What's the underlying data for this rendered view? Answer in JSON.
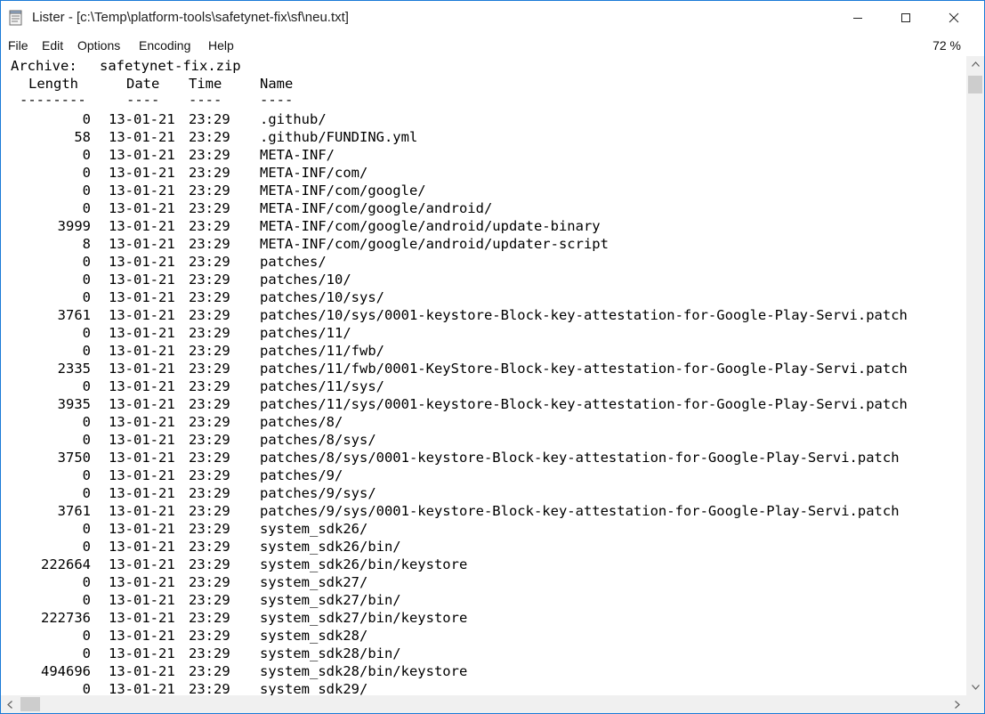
{
  "window": {
    "title": "Lister - [c:\\Temp\\platform-tools\\safetynet-fix\\sf\\neu.txt]"
  },
  "menu": {
    "items": [
      "File",
      "Edit",
      "Options",
      "Encoding",
      "Help"
    ],
    "zoom": "72 %"
  },
  "listing": {
    "archive_label": "Archive:",
    "archive_name": "safetynet-fix.zip",
    "headers": {
      "length": "Length",
      "date": "Date",
      "time": "Time",
      "name": "Name"
    },
    "separators": {
      "length": "--------",
      "date": "----",
      "time": "----",
      "name": "----"
    },
    "rows": [
      {
        "length": "0",
        "date": "13-01-21",
        "time": "23:29",
        "name": ".github/"
      },
      {
        "length": "58",
        "date": "13-01-21",
        "time": "23:29",
        "name": ".github/FUNDING.yml"
      },
      {
        "length": "0",
        "date": "13-01-21",
        "time": "23:29",
        "name": "META-INF/"
      },
      {
        "length": "0",
        "date": "13-01-21",
        "time": "23:29",
        "name": "META-INF/com/"
      },
      {
        "length": "0",
        "date": "13-01-21",
        "time": "23:29",
        "name": "META-INF/com/google/"
      },
      {
        "length": "0",
        "date": "13-01-21",
        "time": "23:29",
        "name": "META-INF/com/google/android/"
      },
      {
        "length": "3999",
        "date": "13-01-21",
        "time": "23:29",
        "name": "META-INF/com/google/android/update-binary"
      },
      {
        "length": "8",
        "date": "13-01-21",
        "time": "23:29",
        "name": "META-INF/com/google/android/updater-script"
      },
      {
        "length": "0",
        "date": "13-01-21",
        "time": "23:29",
        "name": "patches/"
      },
      {
        "length": "0",
        "date": "13-01-21",
        "time": "23:29",
        "name": "patches/10/"
      },
      {
        "length": "0",
        "date": "13-01-21",
        "time": "23:29",
        "name": "patches/10/sys/"
      },
      {
        "length": "3761",
        "date": "13-01-21",
        "time": "23:29",
        "name": "patches/10/sys/0001-keystore-Block-key-attestation-for-Google-Play-Servi.patch"
      },
      {
        "length": "0",
        "date": "13-01-21",
        "time": "23:29",
        "name": "patches/11/"
      },
      {
        "length": "0",
        "date": "13-01-21",
        "time": "23:29",
        "name": "patches/11/fwb/"
      },
      {
        "length": "2335",
        "date": "13-01-21",
        "time": "23:29",
        "name": "patches/11/fwb/0001-KeyStore-Block-key-attestation-for-Google-Play-Servi.patch"
      },
      {
        "length": "0",
        "date": "13-01-21",
        "time": "23:29",
        "name": "patches/11/sys/"
      },
      {
        "length": "3935",
        "date": "13-01-21",
        "time": "23:29",
        "name": "patches/11/sys/0001-keystore-Block-key-attestation-for-Google-Play-Servi.patch"
      },
      {
        "length": "0",
        "date": "13-01-21",
        "time": "23:29",
        "name": "patches/8/"
      },
      {
        "length": "0",
        "date": "13-01-21",
        "time": "23:29",
        "name": "patches/8/sys/"
      },
      {
        "length": "3750",
        "date": "13-01-21",
        "time": "23:29",
        "name": "patches/8/sys/0001-keystore-Block-key-attestation-for-Google-Play-Servi.patch"
      },
      {
        "length": "0",
        "date": "13-01-21",
        "time": "23:29",
        "name": "patches/9/"
      },
      {
        "length": "0",
        "date": "13-01-21",
        "time": "23:29",
        "name": "patches/9/sys/"
      },
      {
        "length": "3761",
        "date": "13-01-21",
        "time": "23:29",
        "name": "patches/9/sys/0001-keystore-Block-key-attestation-for-Google-Play-Servi.patch"
      },
      {
        "length": "0",
        "date": "13-01-21",
        "time": "23:29",
        "name": "system_sdk26/"
      },
      {
        "length": "0",
        "date": "13-01-21",
        "time": "23:29",
        "name": "system_sdk26/bin/"
      },
      {
        "length": "222664",
        "date": "13-01-21",
        "time": "23:29",
        "name": "system_sdk26/bin/keystore"
      },
      {
        "length": "0",
        "date": "13-01-21",
        "time": "23:29",
        "name": "system_sdk27/"
      },
      {
        "length": "0",
        "date": "13-01-21",
        "time": "23:29",
        "name": "system_sdk27/bin/"
      },
      {
        "length": "222736",
        "date": "13-01-21",
        "time": "23:29",
        "name": "system_sdk27/bin/keystore"
      },
      {
        "length": "0",
        "date": "13-01-21",
        "time": "23:29",
        "name": "system_sdk28/"
      },
      {
        "length": "0",
        "date": "13-01-21",
        "time": "23:29",
        "name": "system_sdk28/bin/"
      },
      {
        "length": "494696",
        "date": "13-01-21",
        "time": "23:29",
        "name": "system_sdk28/bin/keystore"
      },
      {
        "length": "0",
        "date": "13-01-21",
        "time": "23:29",
        "name": "system_sdk29/"
      }
    ]
  },
  "icons": {
    "app": "notepad-icon",
    "minimize": "minimize-icon",
    "maximize": "maximize-icon",
    "close": "close-icon"
  },
  "colors": {
    "window_border": "#1a7ad7",
    "scrollbar_track": "#f0f0f0",
    "scrollbar_thumb": "#cdcdcd"
  }
}
